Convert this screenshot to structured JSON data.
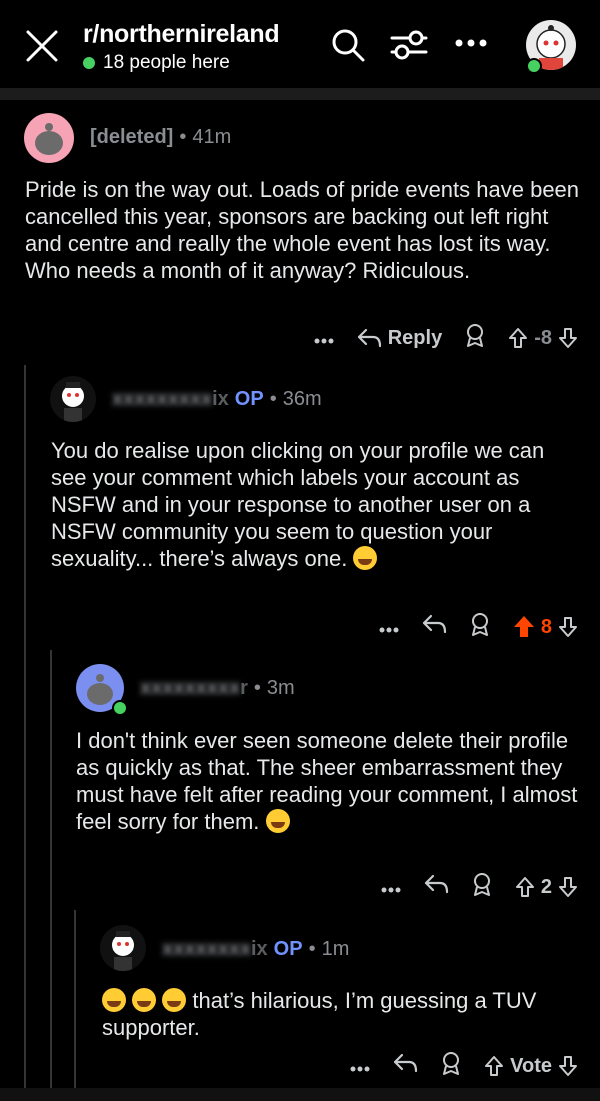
{
  "header": {
    "subreddit": "r/northernireland",
    "online_count": "18 people here"
  },
  "comments": [
    {
      "user": "[deleted]",
      "op_badge": "",
      "time": "41m",
      "body": "Pride is on the way out. Loads of pride events have been cancelled this year, sponsors are backing out left right and centre and really the whole event has lost its way. Who needs a month of it anyway? Ridiculous.",
      "reply_label": "Reply",
      "score": "-8"
    },
    {
      "user": "ix",
      "op_badge": "OP",
      "time": "36m",
      "body": "You do realise upon clicking on your profile we can see your comment which labels your account as NSFW and in your response to another user on a NSFW community you seem to question your sexuality... there’s always one.",
      "score": "8"
    },
    {
      "user": "r",
      "op_badge": "",
      "time": "3m",
      "body": "I don't think ever seen someone delete their profile as quickly as that. The sheer embarrassment they must have felt after reading your comment, I almost feel sorry for them.",
      "score": "2"
    },
    {
      "user": "ix",
      "op_badge": "OP",
      "time": "1m",
      "body": "that’s hilarious, I’m guessing a TUV supporter.",
      "score": "Vote"
    }
  ],
  "colors": {
    "background": "#000000",
    "upvote_active": "#ff4500",
    "op": "#7193ff",
    "online": "#46d160"
  }
}
